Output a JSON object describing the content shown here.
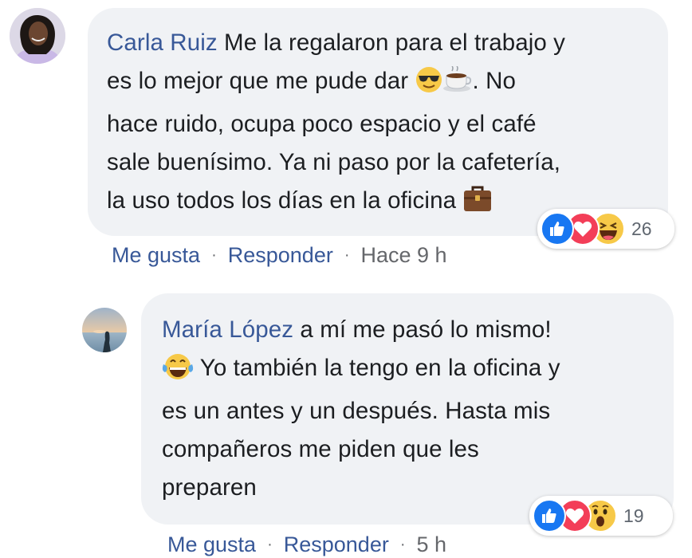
{
  "comments": [
    {
      "author": "Carla Ruiz",
      "lines": [
        "Me la regalaron para el trabajo y",
        "es lo mejor que me pude dar",
        ". No",
        "hace ruido, ocupa poco espacio y el café",
        "sale buenísimo. Ya ni paso por la cafetería,",
        "la uso todos los días en la oficina"
      ],
      "emojis": [
        "sunglasses-emoji",
        "coffee-emoji",
        "briefcase-emoji"
      ],
      "reactions": {
        "types": [
          "like",
          "love",
          "haha"
        ],
        "count": "26"
      },
      "actions": {
        "like": "Me gusta",
        "reply": "Responder",
        "time": "Hace 9 h"
      }
    },
    {
      "author": "María López",
      "lines": [
        "a mí me pasó lo mismo!",
        "Yo también la tengo en la oficina y",
        "es un antes y un después. Hasta mis",
        "compañeros me piden que les",
        "preparen"
      ],
      "emojis": [
        "tears-of-joy-emoji"
      ],
      "reactions": {
        "types": [
          "like",
          "love",
          "wow"
        ],
        "count": "19"
      },
      "actions": {
        "like": "Me gusta",
        "reply": "Responder",
        "time": "5 h"
      }
    }
  ],
  "colors": {
    "author": "#385898",
    "bubble": "#f0f2f5",
    "like": "#1877f2",
    "love": "#f33e58",
    "emoji_yellow": "#f7c948"
  }
}
